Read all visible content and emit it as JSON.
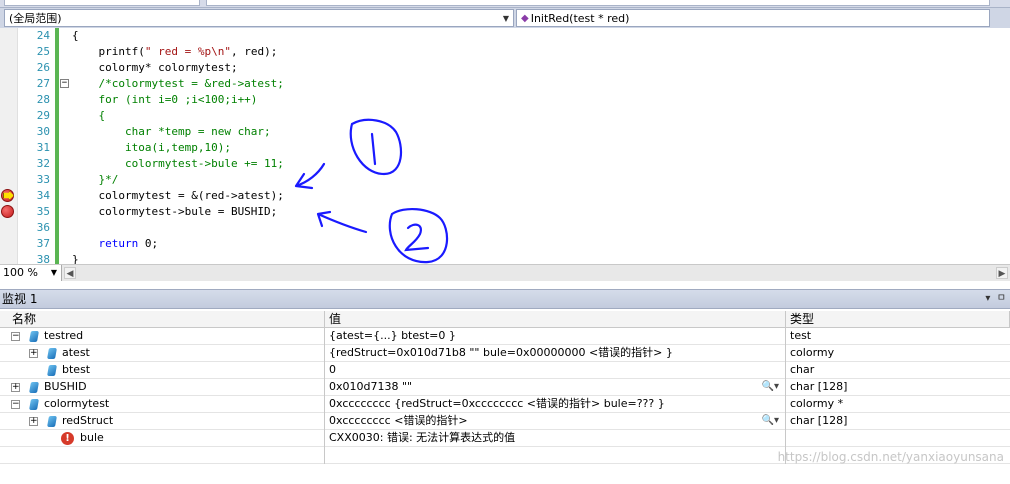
{
  "navbar": {
    "scope": "(全局范围)",
    "function": "InitRed(test * red)"
  },
  "editor": {
    "lines": [
      {
        "n": "24",
        "code": "{"
      },
      {
        "n": "25",
        "code": "    printf(\" red = %p\\n\", red);"
      },
      {
        "n": "26",
        "code": "    colormy* colormytest;"
      },
      {
        "n": "27",
        "code": "    /*colormytest = &red->atest;"
      },
      {
        "n": "28",
        "code": "    for (int i=0 ;i<100;i++)"
      },
      {
        "n": "29",
        "code": "    {"
      },
      {
        "n": "30",
        "code": "        char *temp = new char;"
      },
      {
        "n": "31",
        "code": "        itoa(i,temp,10);"
      },
      {
        "n": "32",
        "code": "        colormytest->bule += 11;"
      },
      {
        "n": "33",
        "code": "    }*/"
      },
      {
        "n": "34",
        "code": "    colormytest = &(red->atest);"
      },
      {
        "n": "35",
        "code": "    colormytest->bule = BUSHID;"
      },
      {
        "n": "36",
        "code": ""
      },
      {
        "n": "37",
        "code": "    return 0;"
      },
      {
        "n": "38",
        "code": "}"
      }
    ],
    "current_line": "34",
    "breakpoint_lines": [
      "34",
      "35"
    ]
  },
  "zoom": "100 %",
  "watch": {
    "title": "监视 1",
    "columns": {
      "name": "名称",
      "value": "值",
      "type": "类型"
    },
    "rows": [
      {
        "name": "testred",
        "value": "{atest={...} btest=0 }",
        "type": "test"
      },
      {
        "name": "atest",
        "value": "{redStruct=0x010d71b8 \"\" bule=0x00000000 <错误的指针> }",
        "type": "colormy"
      },
      {
        "name": "btest",
        "value": "0",
        "type": "char"
      },
      {
        "name": "BUSHID",
        "value": "0x010d7138 \"\"",
        "type": "char [128]"
      },
      {
        "name": "colormytest",
        "value": "0xcccccccc {redStruct=0xcccccccc <错误的指针> bule=??? }",
        "type": "colormy *"
      },
      {
        "name": "redStruct",
        "value": "0xcccccccc <错误的指针>",
        "type": "char [128]"
      },
      {
        "name": "bule",
        "value": "CXX0030: 错误: 无法计算表达式的值",
        "type": ""
      }
    ]
  },
  "watermark": "https://blog.csdn.net/yanxiaoyunsana",
  "colors": {
    "accent_green": "#5ab552",
    "breakpoint_red": "#c41b1b",
    "annotation_blue": "#1a1aff"
  }
}
